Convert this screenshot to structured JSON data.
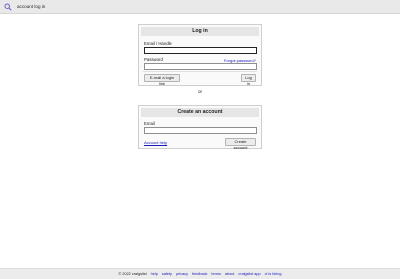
{
  "topbar": {
    "icon": "search-icon",
    "breadcrumb": "account log in"
  },
  "login": {
    "title": "Log in",
    "email_label": "Email / Handle",
    "email_value": "",
    "password_label": "Password",
    "forgot_link": "Forgot password?",
    "password_value": "",
    "email_login_button": "E-mail a login link",
    "login_button": "Log in"
  },
  "or_text": "or",
  "create": {
    "title": "Create an account",
    "email_label": "Email",
    "email_value": "",
    "help_link": "Account help",
    "create_button": "Create account"
  },
  "footer": {
    "copyright": "© 2022 craigslist",
    "links": [
      "help",
      "safety",
      "privacy",
      "feedback",
      "terms",
      "about",
      "craigslist app",
      "cl is hiring"
    ]
  }
}
